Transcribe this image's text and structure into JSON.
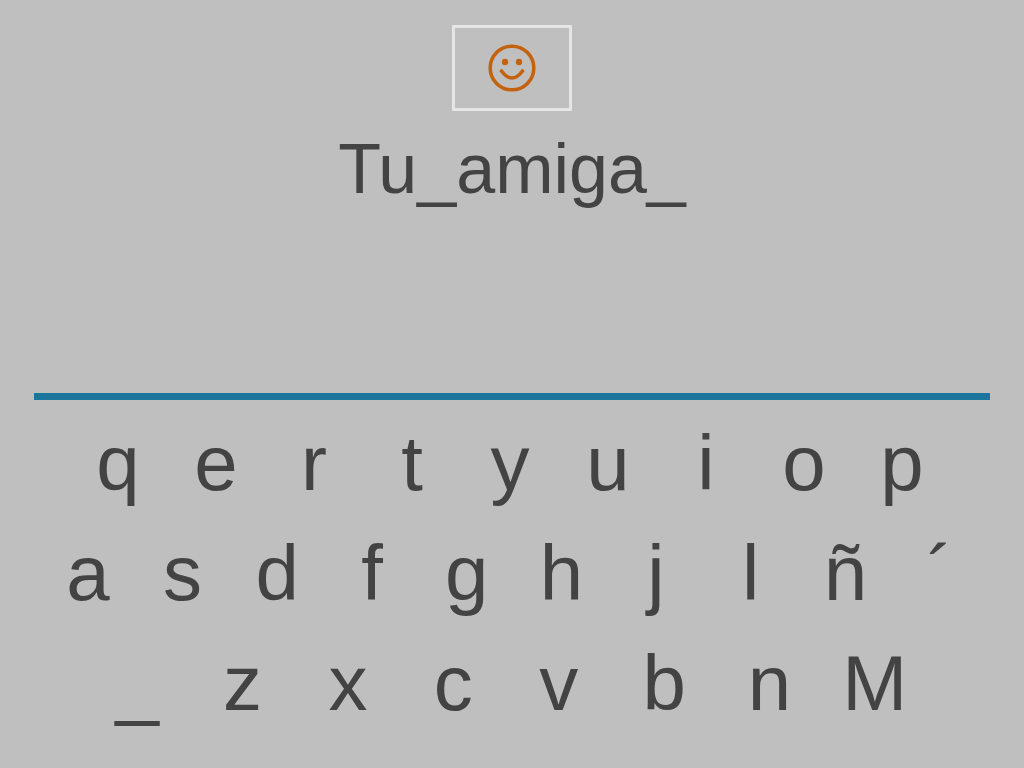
{
  "word": "Tu_amiga_",
  "keyboard": {
    "rows": [
      {
        "keys": [
          "q",
          "e",
          "r",
          "t",
          "y",
          "u",
          "i",
          "o",
          "p"
        ]
      },
      {
        "keys": [
          "a",
          "s",
          "d",
          "f",
          "g",
          "h",
          "j",
          "l",
          "ñ",
          "´"
        ]
      },
      {
        "keys": [
          "_",
          "z",
          "x",
          "c",
          "v",
          "b",
          "n",
          "M"
        ]
      }
    ]
  }
}
